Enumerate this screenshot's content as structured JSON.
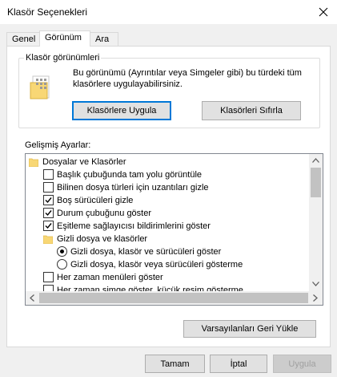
{
  "window": {
    "title": "Klasör Seçenekleri"
  },
  "tabs": [
    {
      "label": "Genel"
    },
    {
      "label": "Görünüm"
    },
    {
      "label": "Ara"
    }
  ],
  "folder_views": {
    "group_label": "Klasör görünümleri",
    "description": "Bu görünümü (Ayrıntılar veya Simgeler gibi) bu türdeki tüm klasörlere uygulayabilirsiniz.",
    "apply_button": "Klasörlere Uygula",
    "reset_button": "Klasörleri Sıfırla"
  },
  "advanced": {
    "label": "Gelişmiş Ayarlar:",
    "items": [
      {
        "type": "folder",
        "label": "Dosyalar ve Klasörler"
      },
      {
        "type": "checkbox",
        "label": "Başlık çubuğunda tam yolu görüntüle",
        "checked": false
      },
      {
        "type": "checkbox",
        "label": "Bilinen dosya türleri için uzantıları gizle",
        "checked": false
      },
      {
        "type": "checkbox",
        "label": "Boş sürücüleri gizle",
        "checked": true
      },
      {
        "type": "checkbox",
        "label": "Durum çubuğunu göster",
        "checked": true
      },
      {
        "type": "checkbox",
        "label": "Eşitleme sağlayıcısı bildirimlerini göster",
        "checked": true
      },
      {
        "type": "folder",
        "label": "Gizli dosya ve klasörler"
      },
      {
        "type": "radio",
        "label": "Gizli dosya, klasör ve sürücüleri göster",
        "checked": true
      },
      {
        "type": "radio",
        "label": "Gizli dosya, klasör veya sürücüleri gösterme",
        "checked": false
      },
      {
        "type": "checkbox",
        "label": "Her zaman menüleri göster",
        "checked": false
      },
      {
        "type": "checkbox",
        "label": "Her zaman simge göster, küçük resim gösterme",
        "checked": false
      }
    ],
    "restore_button": "Varsayılanları Geri Yükle"
  },
  "footer": {
    "ok": "Tamam",
    "cancel": "İptal",
    "apply": "Uygula"
  },
  "colors": {
    "accent": "#0078d7",
    "folder": "#f8d775"
  },
  "icons": {
    "close": "close-icon",
    "folder_view": "folder-view-icon",
    "folder": "folder-icon",
    "check": "check-icon"
  }
}
